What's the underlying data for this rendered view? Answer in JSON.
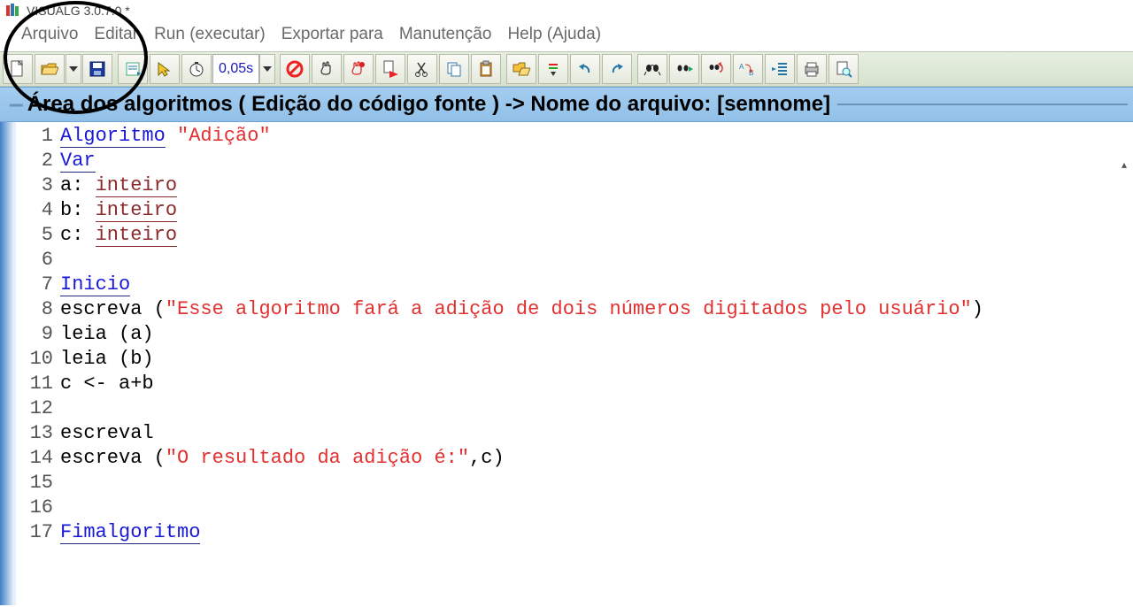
{
  "title": "VISUALG 3.0.7.0 *",
  "menu": {
    "arquivo": "Arquivo",
    "editar": "Editar",
    "run": "Run (executar)",
    "exportar": "Exportar para",
    "manutencao": "Manutenção",
    "help": "Help (Ajuda)"
  },
  "toolbar": {
    "timer_value": "0,05s"
  },
  "caption": {
    "text": "Área dos algoritmos ( Edição do código fonte ) -> Nome do arquivo: [semnome]"
  },
  "code": {
    "lines": [
      {
        "n": "1",
        "segs": [
          {
            "t": "Algoritmo",
            "c": "kw-blue"
          },
          {
            "t": " ",
            "c": "id"
          },
          {
            "t": "\"Adição\"",
            "c": "str"
          }
        ]
      },
      {
        "n": "2",
        "segs": [
          {
            "t": "Var",
            "c": "kw-blue"
          }
        ]
      },
      {
        "n": "3",
        "segs": [
          {
            "t": "a:",
            "c": "id"
          },
          {
            "t": " ",
            "c": "id"
          },
          {
            "t": "inteiro",
            "c": "kw-brown"
          }
        ]
      },
      {
        "n": "4",
        "segs": [
          {
            "t": "b:",
            "c": "id"
          },
          {
            "t": " ",
            "c": "id"
          },
          {
            "t": "inteiro",
            "c": "kw-brown"
          }
        ]
      },
      {
        "n": "5",
        "segs": [
          {
            "t": "c:",
            "c": "id"
          },
          {
            "t": " ",
            "c": "id"
          },
          {
            "t": "inteiro",
            "c": "kw-brown"
          }
        ]
      },
      {
        "n": "6",
        "segs": [
          {
            "t": "",
            "c": "id"
          }
        ]
      },
      {
        "n": "7",
        "segs": [
          {
            "t": "Inicio",
            "c": "kw-blue"
          }
        ]
      },
      {
        "n": "8",
        "segs": [
          {
            "t": "escreva ",
            "c": "id"
          },
          {
            "t": "(",
            "c": "punc"
          },
          {
            "t": "\"Esse algoritmo fará a adição de dois números digitados pelo usuário\"",
            "c": "str"
          },
          {
            "t": ")",
            "c": "punc"
          }
        ]
      },
      {
        "n": "9",
        "segs": [
          {
            "t": "leia ",
            "c": "id"
          },
          {
            "t": "(a)",
            "c": "punc"
          }
        ]
      },
      {
        "n": "10",
        "segs": [
          {
            "t": "leia ",
            "c": "id"
          },
          {
            "t": "(b)",
            "c": "punc"
          }
        ]
      },
      {
        "n": "11",
        "segs": [
          {
            "t": "c <- a+b",
            "c": "id"
          }
        ]
      },
      {
        "n": "12",
        "segs": [
          {
            "t": "",
            "c": "id"
          }
        ]
      },
      {
        "n": "13",
        "segs": [
          {
            "t": "escreval",
            "c": "id"
          }
        ]
      },
      {
        "n": "14",
        "segs": [
          {
            "t": "escreva ",
            "c": "id"
          },
          {
            "t": "(",
            "c": "punc"
          },
          {
            "t": "\"O resultado da adição é:\"",
            "c": "str"
          },
          {
            "t": ",c",
            "c": "punc"
          },
          {
            "t": ")",
            "c": "punc"
          }
        ]
      },
      {
        "n": "15",
        "segs": [
          {
            "t": "",
            "c": "id"
          }
        ]
      },
      {
        "n": "16",
        "segs": [
          {
            "t": "",
            "c": "id"
          }
        ]
      },
      {
        "n": "17",
        "segs": [
          {
            "t": "Fimalgoritmo",
            "c": "kw-blue"
          }
        ]
      }
    ]
  }
}
